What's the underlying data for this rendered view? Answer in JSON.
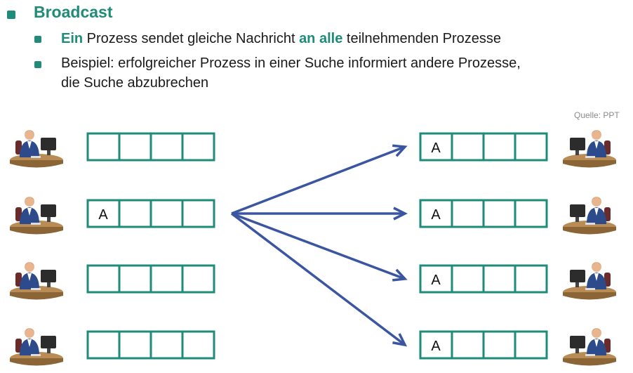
{
  "title": "Broadcast",
  "bullets": [
    {
      "parts": [
        {
          "text": "Ein",
          "hl": true
        },
        {
          "text": " Prozess sendet gleiche Nachricht ",
          "hl": false
        },
        {
          "text": "an alle",
          "hl": true
        },
        {
          "text": " teilnehmenden Prozesse",
          "hl": false
        }
      ]
    },
    {
      "parts": [
        {
          "text": "Beispiel: erfolgreicher Prozess in einer Suche informiert andere Prozesse,",
          "hl": false
        }
      ]
    },
    {
      "parts": [
        {
          "text": "die Suche abzubrechen",
          "hl": false
        }
      ]
    }
  ],
  "source": "Quelle: PPT",
  "left_buffers": [
    {
      "cells": [
        "",
        "",
        "",
        ""
      ]
    },
    {
      "cells": [
        "A",
        "",
        "",
        ""
      ]
    },
    {
      "cells": [
        "",
        "",
        "",
        ""
      ]
    },
    {
      "cells": [
        "",
        "",
        "",
        ""
      ]
    }
  ],
  "right_buffers": [
    {
      "cells": [
        "A",
        "",
        "",
        ""
      ]
    },
    {
      "cells": [
        "A",
        "",
        "",
        ""
      ]
    },
    {
      "cells": [
        "A",
        "",
        "",
        ""
      ]
    },
    {
      "cells": [
        "A",
        "",
        "",
        ""
      ]
    }
  ],
  "colors": {
    "accent": "#1e8c78",
    "arrow": "#3b56a0",
    "buffer_border": "#1e8c78"
  },
  "icons": [
    "person-at-computer-icon"
  ]
}
